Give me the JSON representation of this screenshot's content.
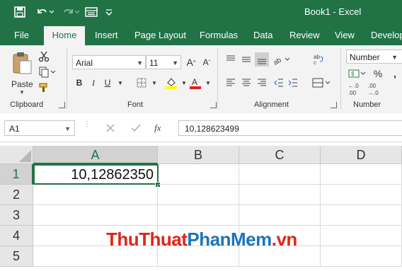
{
  "window": {
    "title": "Book1 - Excel"
  },
  "qat": {
    "save_icon": "save-icon",
    "undo_icon": "undo-icon",
    "redo_icon": "redo-icon",
    "form_icon": "form-icon",
    "customize_icon": "chevron-down-icon"
  },
  "tabs": [
    {
      "label": "File"
    },
    {
      "label": "Home",
      "active": true
    },
    {
      "label": "Insert"
    },
    {
      "label": "Page Layout"
    },
    {
      "label": "Formulas"
    },
    {
      "label": "Data"
    },
    {
      "label": "Review"
    },
    {
      "label": "View"
    },
    {
      "label": "Develop"
    }
  ],
  "ribbon": {
    "clipboard": {
      "label": "Clipboard",
      "paste_label": "Paste"
    },
    "font": {
      "label": "Font",
      "font_name": "Arial",
      "font_size": "11"
    },
    "alignment": {
      "label": "Alignment"
    },
    "number": {
      "label": "Number",
      "format": "Number"
    }
  },
  "formula_bar": {
    "name_box": "A1",
    "fx_label": "fx",
    "content": "10,128623499"
  },
  "sheet": {
    "columns": [
      "A",
      "B",
      "C",
      "D"
    ],
    "rows": [
      "1",
      "2",
      "3",
      "4",
      "5"
    ],
    "active_cell": "A1",
    "cells": {
      "A1": "10,12862350"
    }
  },
  "watermark": {
    "part1": "ThuThuat",
    "part2": "PhanMem",
    "part3": ".vn"
  },
  "colors": {
    "accent": "#217346",
    "watermark_red": "#e0251b",
    "watermark_blue": "#1b75bb"
  }
}
